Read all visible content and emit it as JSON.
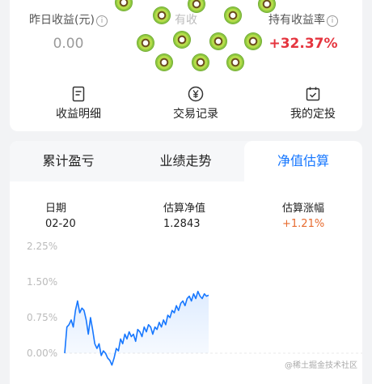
{
  "summary": {
    "yesterday_label": "昨日收益(元)",
    "yesterday_value": "0.00",
    "middle_label_visible": "有收",
    "hold_label": "持有收益率",
    "hold_value": "+32.37%"
  },
  "actions": [
    {
      "label": "收益明细",
      "icon": "document-list-icon"
    },
    {
      "label": "交易记录",
      "icon": "yen-circle-icon"
    },
    {
      "label": "我的定投",
      "icon": "calendar-check-icon"
    }
  ],
  "tabs": [
    {
      "label": "累计盈亏"
    },
    {
      "label": "业绩走势"
    },
    {
      "label": "净值估算",
      "active": true
    }
  ],
  "estimate": {
    "date_label": "日期",
    "date_value": "02-20",
    "nav_label": "估算净值",
    "nav_value": "1.2843",
    "change_label": "估算涨幅",
    "change_value": "+1.21%"
  },
  "chart_data": {
    "type": "line",
    "y_ticks": [
      "2.25%",
      "1.50%",
      "0.75%",
      "0.00%"
    ],
    "ylim": [
      -0.25,
      2.25
    ],
    "series": [
      {
        "values": [
          0.0,
          0.55,
          0.6,
          0.7,
          0.55,
          0.9,
          1.1,
          0.85,
          0.95,
          0.9,
          0.7,
          0.4,
          0.75,
          0.5,
          0.2,
          0.1,
          0.2,
          -0.05,
          0.05,
          0.0,
          -0.1,
          -0.15,
          -0.25,
          -0.1,
          0.1,
          0.05,
          0.3,
          0.2,
          0.4,
          0.3,
          0.45,
          0.35,
          0.4,
          0.25,
          0.5,
          0.45,
          0.35,
          0.55,
          0.45,
          0.6,
          0.55,
          0.4,
          0.55,
          0.5,
          0.65,
          0.55,
          0.7,
          0.6,
          0.8,
          0.75,
          0.9,
          0.85,
          1.0,
          0.9,
          1.05,
          1.1,
          1.0,
          1.15,
          1.2,
          1.1,
          1.25,
          1.15,
          1.3,
          1.2,
          1.15,
          1.25,
          1.2,
          1.22
        ],
        "color": "#1677ff"
      }
    ],
    "grid": false
  },
  "watermark": "@稀土掘金技术社区",
  "colors": {
    "accent": "#1677ff",
    "positive": "#e5353f",
    "change": "#e76b2f"
  }
}
